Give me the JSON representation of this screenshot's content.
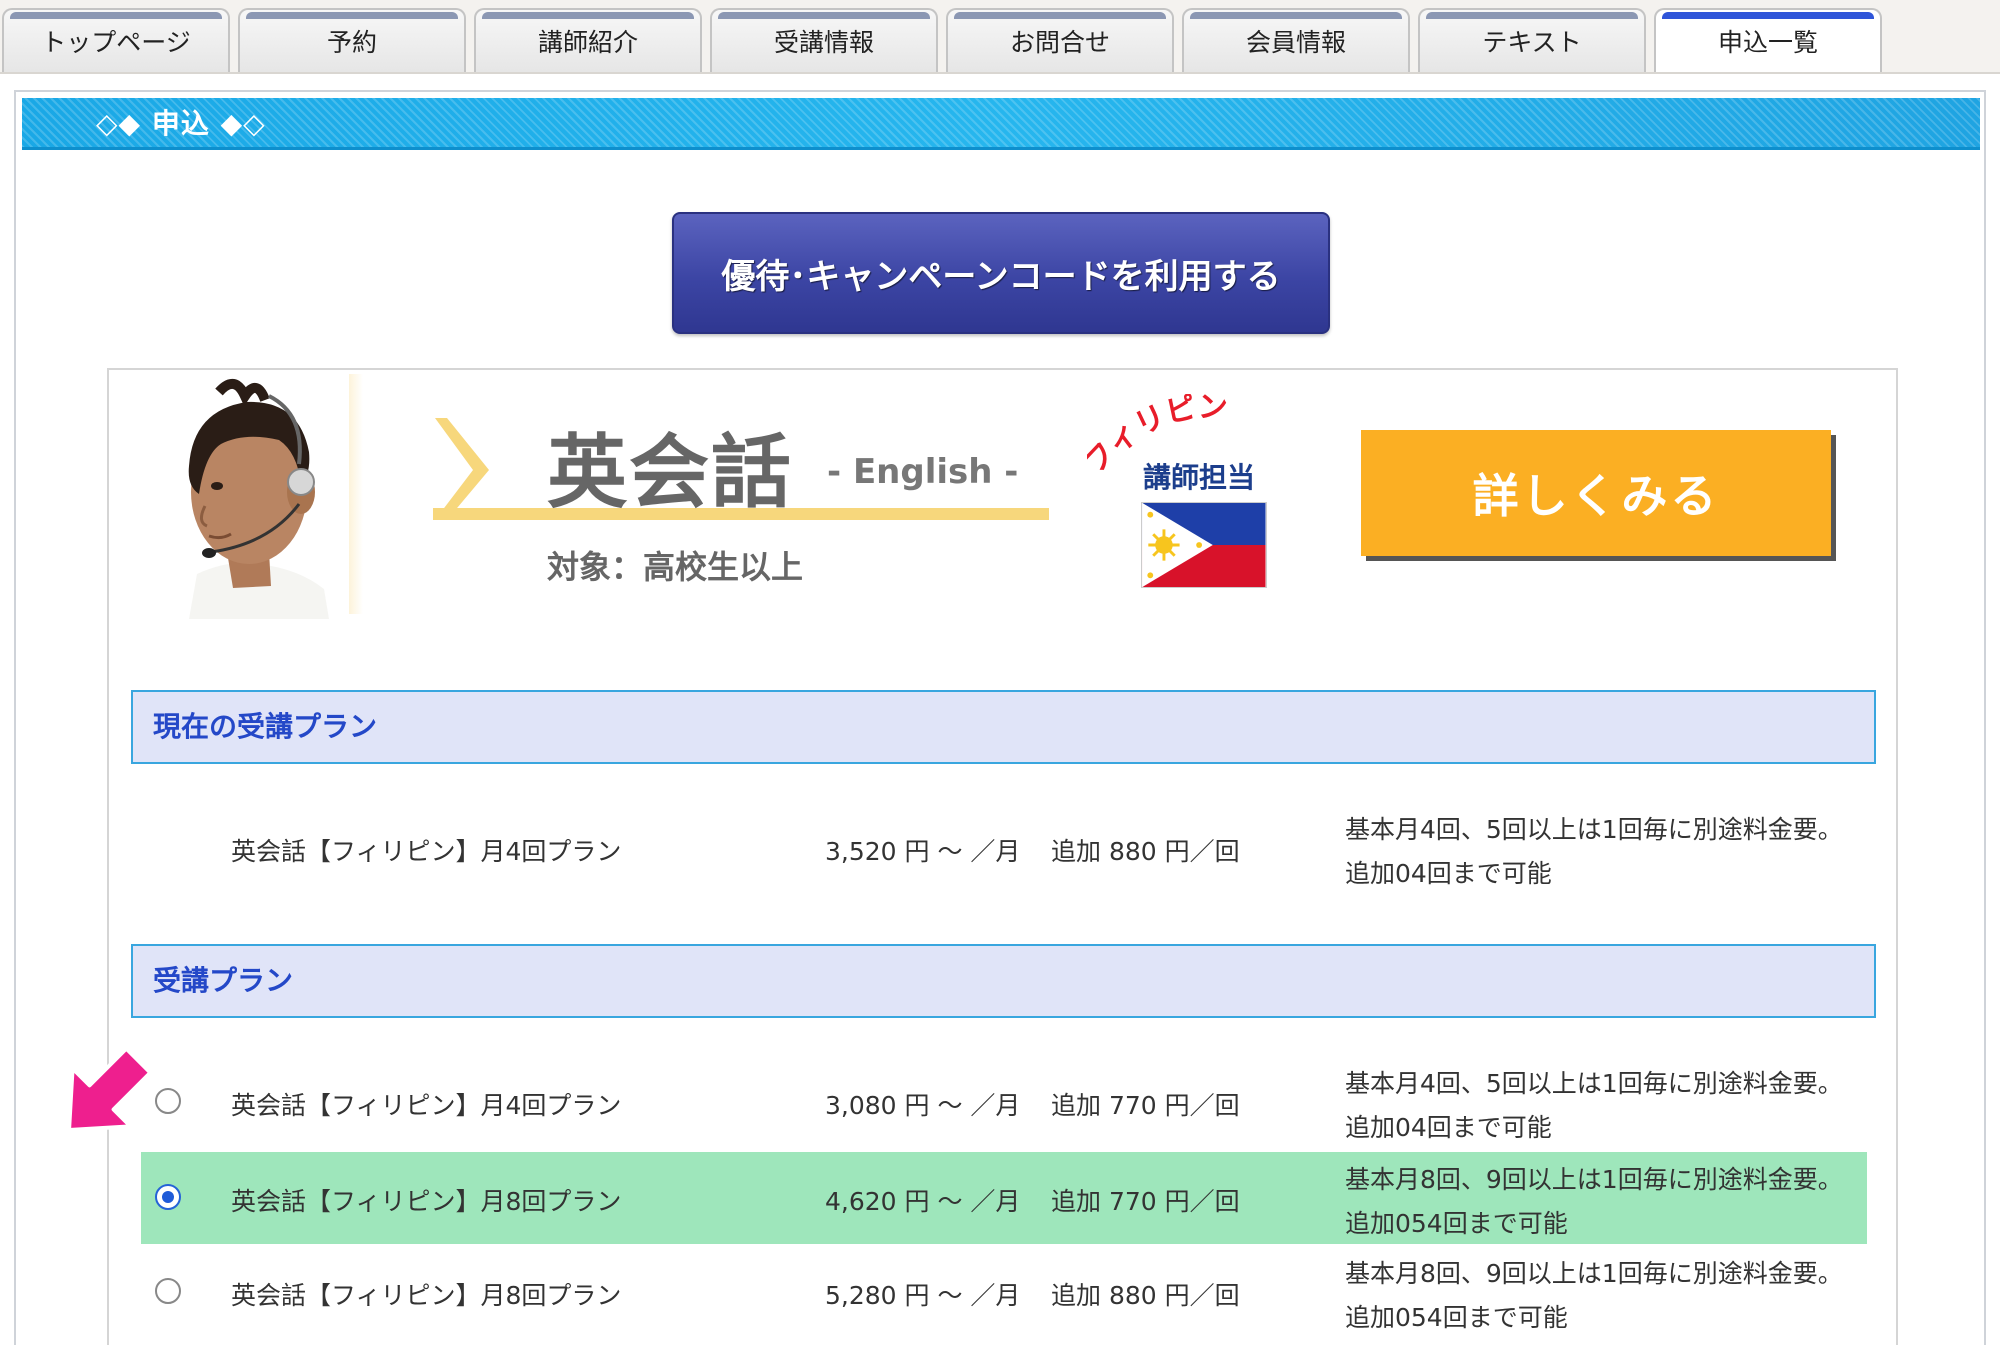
{
  "tabs": [
    {
      "label": "トップページ"
    },
    {
      "label": "予約"
    },
    {
      "label": "講師紹介"
    },
    {
      "label": "受講情報"
    },
    {
      "label": "お問合せ"
    },
    {
      "label": "会員情報"
    },
    {
      "label": "テキスト"
    },
    {
      "label": "申込一覧"
    }
  ],
  "active_tab": "申込一覧",
  "panel": {
    "title": "◇◆ 申込 ◆◇"
  },
  "campaign_button": {
    "label": "優待･キャンペーンコードを利用する"
  },
  "course": {
    "title": "英会話",
    "english": "- English -",
    "target": "対象：高校生以上",
    "country": "フィリピン",
    "teacher_label": "講師担当",
    "detail_button": "詳しくみる"
  },
  "current_plan": {
    "heading": "現在の受講プラン",
    "row": {
      "name": "英会話【フィリピン】月4回プラン",
      "price": "3,520 円 ～ ／月",
      "extra": "追加 880 円／回",
      "note1": "基本月4回、5回以上は1回毎に別途料金要。",
      "note2": "追加04回まで可能"
    }
  },
  "plans": {
    "heading": "受講プラン",
    "rows": [
      {
        "name": "英会話【フィリピン】月4回プラン",
        "price": "3,080 円 ～ ／月",
        "extra": "追加 770 円／回",
        "note1": "基本月4回、5回以上は1回毎に別途料金要。",
        "note2": "追加04回まで可能",
        "selected": false
      },
      {
        "name": "英会話【フィリピン】月8回プラン",
        "price": "4,620 円 ～ ／月",
        "extra": "追加 770 円／回",
        "note1": "基本月8回、9回以上は1回毎に別途料金要。",
        "note2": "追加054回まで可能",
        "selected": true
      },
      {
        "name": "英会話【フィリピン】月8回プラン",
        "price": "5,280 円 ～ ／月",
        "extra": "追加 880 円／回",
        "note1": "基本月8回、9回以上は1回毎に別途料金要。",
        "note2": "追加054回まで可能",
        "selected": false
      }
    ]
  },
  "colors": {
    "header_blue": "#1aa8e6",
    "campaign_button": "#3c45a4",
    "detail_button": "#fbaf23",
    "section_bg": "#e0e4f8",
    "section_text": "#2448c8",
    "selected_row": "#9ee6bb",
    "arrow": "#ee1f8e"
  },
  "icons": {
    "arrow": "pointer-arrow-icon",
    "flag": "philippines-flag-icon",
    "chevron": "chevron-right-icon"
  }
}
